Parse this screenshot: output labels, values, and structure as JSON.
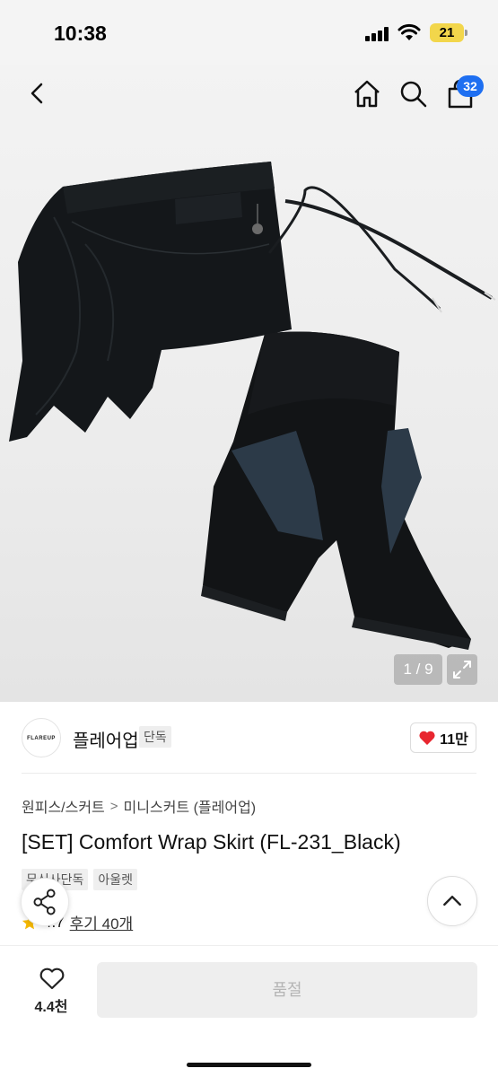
{
  "status_bar": {
    "time": "10:38",
    "battery": "21"
  },
  "nav": {
    "back_icon": "chevron-left-icon",
    "home_icon": "home-icon",
    "search_icon": "search-icon",
    "bag_icon": "shopping-bag-icon",
    "bag_count": "32"
  },
  "gallery": {
    "counter": "1 / 9",
    "expand_icon": "expand-icon",
    "image_subject": "black wrap skirt and black biker shorts set"
  },
  "brand": {
    "logo_text": "FLAREUP",
    "name": "플레어업",
    "tag": "단독",
    "like_count": "11만"
  },
  "breadcrumb": {
    "level1": "원피스/스커트",
    "separator": ">",
    "level2": "미니스커트 (플레어업)"
  },
  "product": {
    "title": "[SET] Comfort Wrap Skirt (FL-231_Black)",
    "tags": [
      "무신사단독",
      "아울렛"
    ],
    "rating": "4.7",
    "reviews": "후기 40개"
  },
  "bottom_bar": {
    "wish_count": "4.4천",
    "soldout_label": "품절"
  },
  "colors": {
    "accent_blue": "#1e6ff1",
    "heart_red": "#e8262f",
    "star_yellow": "#f5b800",
    "disabled_bg": "#eeeeee",
    "disabled_text": "#b5b5b5"
  }
}
